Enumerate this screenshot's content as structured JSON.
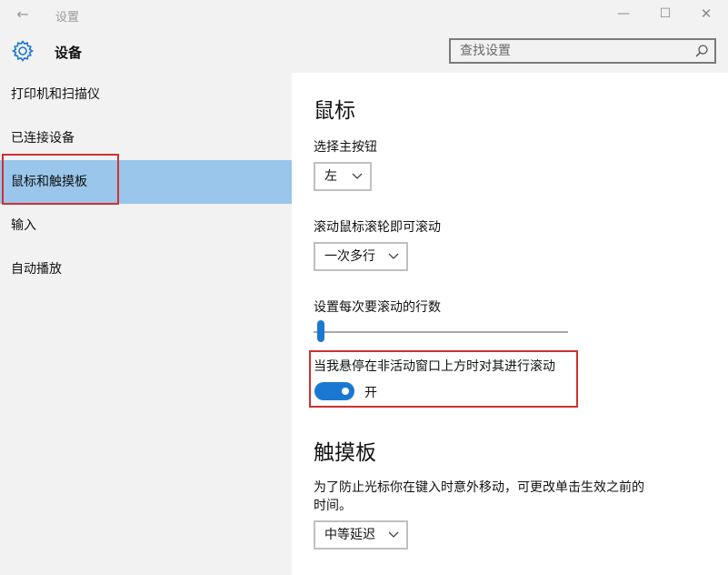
{
  "window": {
    "title": "设置"
  },
  "header": {
    "title": "设备",
    "search_placeholder": "查找设置"
  },
  "sidebar": {
    "items": [
      {
        "label": "打印机和扫描仪",
        "selected": false
      },
      {
        "label": "已连接设备",
        "selected": false
      },
      {
        "label": "鼠标和触摸板",
        "selected": true
      },
      {
        "label": "输入",
        "selected": false
      },
      {
        "label": "自动播放",
        "selected": false
      }
    ]
  },
  "main": {
    "mouse": {
      "heading": "鼠标",
      "primary_button_label": "选择主按钮",
      "primary_button_value": "左",
      "scroll_label": "滚动鼠标滚轮即可滚动",
      "scroll_value": "一次多行",
      "lines_label": "设置每次要滚动的行数",
      "lines_slider_level": 0.02,
      "inactive_scroll_label": "当我悬停在非活动窗口上方时对其进行滚动",
      "inactive_scroll_state": "开"
    },
    "touchpad": {
      "heading": "触摸板",
      "delay_description": "为了防止光标你在键入时意外移动，可更改单击生效之前的",
      "delay_description_cont": "时间。",
      "delay_value": "中等延迟"
    }
  },
  "colors": {
    "accent": "#1a78d2",
    "selected_nav": "#99c6ea",
    "highlight_box": "#d03030"
  }
}
